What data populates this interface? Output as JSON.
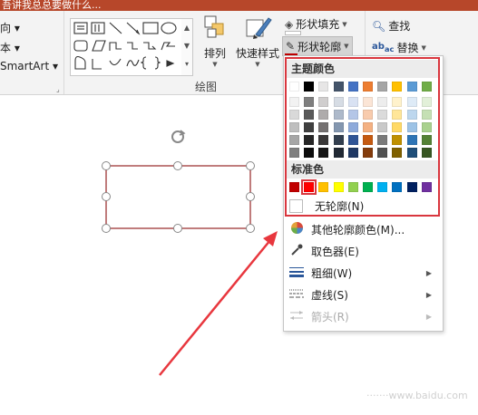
{
  "title_bar": {
    "text": "吾讲我总总要做什么..."
  },
  "ribbon": {
    "left_items": [
      "向 ▾",
      "本 ▾",
      "SmartArt ▾"
    ],
    "drawing_group_label": "绘图",
    "arrange_label": "排列",
    "quick_styles_label": "快速样式",
    "shape_fill_label": "形状填充",
    "shape_outline_label": "形状轮廓",
    "find_label": "查找",
    "replace_label": "替换"
  },
  "dropdown": {
    "theme_colors_title": "主题颜色",
    "standard_colors_title": "标准色",
    "theme_colors": [
      [
        "#ffffff",
        "#f2f2f2",
        "#d9d9d9",
        "#bfbfbf",
        "#a6a6a6",
        "#7f7f7f"
      ],
      [
        "#000000",
        "#7f7f7f",
        "#595959",
        "#404040",
        "#262626",
        "#0d0d0d"
      ],
      [
        "#e7e6e6",
        "#d0cece",
        "#aeabab",
        "#757171",
        "#3a3838",
        "#171616"
      ],
      [
        "#44546a",
        "#d6dce4",
        "#adb9ca",
        "#8497b0",
        "#333f4f",
        "#222a35"
      ],
      [
        "#4472c4",
        "#d9e2f3",
        "#b4c6e7",
        "#8eaadb",
        "#2f5496",
        "#1f3864"
      ],
      [
        "#ed7d31",
        "#fbe5d6",
        "#f8cbad",
        "#f4b183",
        "#c55a11",
        "#843c0c"
      ],
      [
        "#a5a5a5",
        "#ededed",
        "#dbdbdb",
        "#c9c9c9",
        "#7b7b7b",
        "#525252"
      ],
      [
        "#ffc000",
        "#fff2cc",
        "#ffe699",
        "#ffd966",
        "#bf9000",
        "#7f6000"
      ],
      [
        "#5b9bd5",
        "#deebf7",
        "#bdd7ee",
        "#9dc3e6",
        "#2e75b6",
        "#1f4e79"
      ],
      [
        "#70ad47",
        "#e2f0d9",
        "#c5e0b4",
        "#a9d18e",
        "#548235",
        "#385723"
      ]
    ],
    "standard_colors": [
      "#c00000",
      "#ff0000",
      "#ffc000",
      "#ffff00",
      "#92d050",
      "#00b050",
      "#00b0f0",
      "#0070c0",
      "#002060",
      "#7030a0"
    ],
    "no_outline_label": "无轮廓(N)",
    "more_colors_label": "其他轮廓颜色(M)...",
    "eyedropper_label": "取色器(E)",
    "weight_label": "粗细(W)",
    "dashes_label": "虚线(S)",
    "arrows_label": "箭头(R)"
  },
  "watermark": "·······www.baidu.com",
  "colors": {
    "title_bar": "#b7472a",
    "highlight": "#d9363e",
    "selected_outline": "#c00000",
    "arrow": "#e8373e"
  }
}
